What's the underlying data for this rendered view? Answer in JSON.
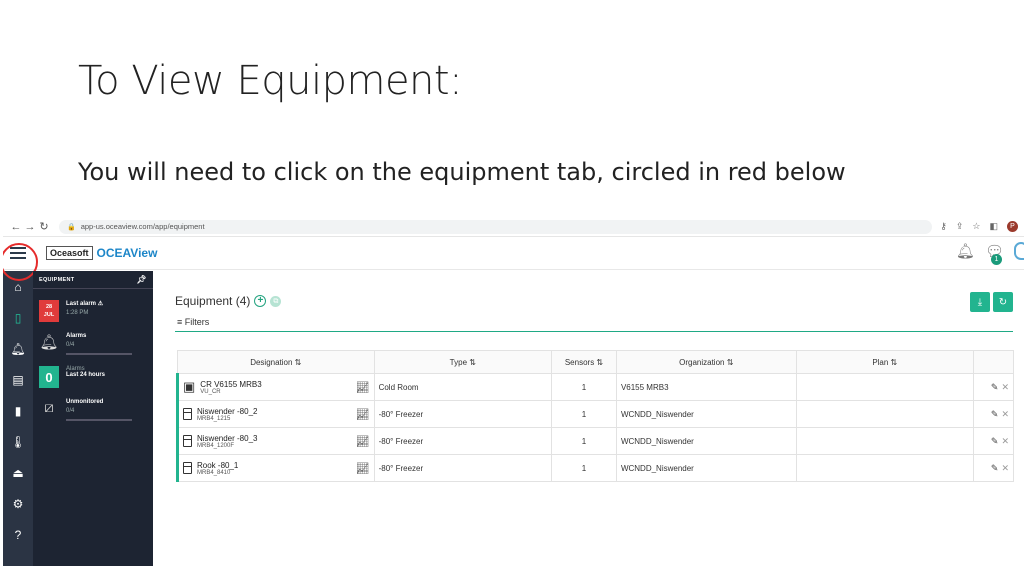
{
  "slide": {
    "title": "To View Equipment:",
    "subtitle": "You will need to click on the equipment tab, circled in red below"
  },
  "browser": {
    "url": "app-us.oceaview.com/app/equipment",
    "profile_initial": "P"
  },
  "app": {
    "brand_box": "Oceasoft",
    "brand_name": "OCEAView",
    "chat_badge": "1"
  },
  "rail": {
    "icons": [
      "home-icon",
      "equipment-icon",
      "bell-icon",
      "report-icon",
      "sensor-icon",
      "thermometer-icon",
      "gateway-icon",
      "gear-icon",
      "help-icon"
    ],
    "active": "equipment-icon",
    "highlight_color": "#e52b2b"
  },
  "panel": {
    "header": "EQUIPMENT",
    "last_alarm": {
      "date_day": "28",
      "date_month": "JUL",
      "label": "Last alarm",
      "time": "1:28 PM"
    },
    "alarms": {
      "label": "Alarms",
      "value": "0/4"
    },
    "last24": {
      "count": "0",
      "label": "Alarms",
      "sublabel": "Last 24 hours"
    },
    "unmonitored": {
      "label": "Unmonitored",
      "value": "0/4"
    }
  },
  "main": {
    "title": "Equipment (4)",
    "filters_label": "Filters",
    "columns": [
      "Designation",
      "Type",
      "Sensors",
      "Organization",
      "Plan"
    ],
    "rows": [
      {
        "name": "CR V6155 MRB3",
        "sub": "VU_CR",
        "icon": "box-icon",
        "type": "Cold Room",
        "sensors": "1",
        "org": "V6155 MRB3",
        "plan": ""
      },
      {
        "name": "Niswender -80_2",
        "sub": "MRB4_1215",
        "icon": "fridge-icon",
        "type": "-80° Freezer",
        "sensors": "1",
        "org": "WCNDD_Niswender",
        "plan": ""
      },
      {
        "name": "Niswender -80_3",
        "sub": "MRB4_1200F",
        "icon": "fridge-icon",
        "type": "-80° Freezer",
        "sensors": "1",
        "org": "WCNDD_Niswender",
        "plan": ""
      },
      {
        "name": "Rook -80_1",
        "sub": "MRB4_8410",
        "icon": "fridge-icon",
        "type": "-80° Freezer",
        "sensors": "1",
        "org": "WCNDD_Niswender",
        "plan": ""
      }
    ]
  },
  "colors": {
    "accent": "#22b48f",
    "rail_bg": "#2b3444",
    "panel_bg": "#1d2432",
    "brand": "#1d86c8"
  }
}
